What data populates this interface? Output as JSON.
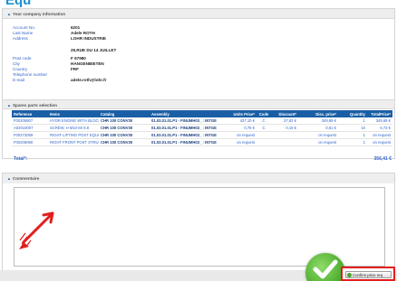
{
  "page": {
    "heading": "Equ"
  },
  "company": {
    "header": "Your company information",
    "rows": [
      {
        "label": "Account No.",
        "value": "6201"
      },
      {
        "label": "Last Name",
        "value": "Adele ROTH"
      },
      {
        "label": "Address",
        "value": "LOHR INDUSTRIE"
      },
      {
        "label": "",
        "value": ""
      },
      {
        "label": "",
        "value": "29,RUE DU 14 JUILLET"
      },
      {
        "label": "Post code",
        "value": "F 67980"
      },
      {
        "label": "City",
        "value": "HANGENBIETEN"
      },
      {
        "label": "Country",
        "value": "FRF"
      },
      {
        "label": "Telephone number",
        "value": ""
      },
      {
        "label": "E-mail",
        "value": "adele.roth@lohr.fr"
      }
    ]
  },
  "spares": {
    "header": "Spares parts selection",
    "columns": [
      "Reference",
      "Items",
      "Catalog",
      "Assembly",
      "Units Price*",
      "Code",
      "Discount*",
      "Disc. price*",
      "Quantity",
      "TotalPrice*"
    ],
    "rows": [
      [
        "F00206807",
        "HYDR ENGINE WITH BLOCK N",
        "CHR 100 CONV30",
        "01.03.01.01.P1 - FINUMH03_ : INTGE",
        "437,10 €",
        "C",
        "37,62 €",
        "349,68 €",
        "1",
        "349,68 €"
      ],
      [
        "A02010007",
        "SCREW, H M10-60 8.8",
        "CHR 100 CONV30",
        "01.03.01.01.P1 - FINUMH03_ : INTGE",
        "0,76 €",
        "C",
        "0,15 €",
        "0,61 €",
        "10",
        "6,73 €"
      ],
      [
        "F00273059",
        "RIGHT LIFTING POST EQUIP",
        "CHR 100 CONV30",
        "01.03.01.01.P1 - FINUMH03_ : INTGE",
        "on request",
        "",
        "",
        "on request",
        "1",
        "on request"
      ],
      [
        "F00206090",
        "RIGHT FRONT POST STRUCT",
        "CHR 100 CONV30",
        "01.03.01.01.P1 - FINUMH03_ : INTGE",
        "on request",
        "",
        "",
        "on request",
        "1",
        "on request"
      ]
    ],
    "total_label": "Total*:",
    "total_value": "356,41 €"
  },
  "comments": {
    "header": "Commentaire",
    "value": ""
  },
  "confirm": {
    "label": "Confirm price req"
  },
  "colors": {
    "accent": "#1a5fa6",
    "highlight": "#e21e1e",
    "success": "#44a625"
  }
}
